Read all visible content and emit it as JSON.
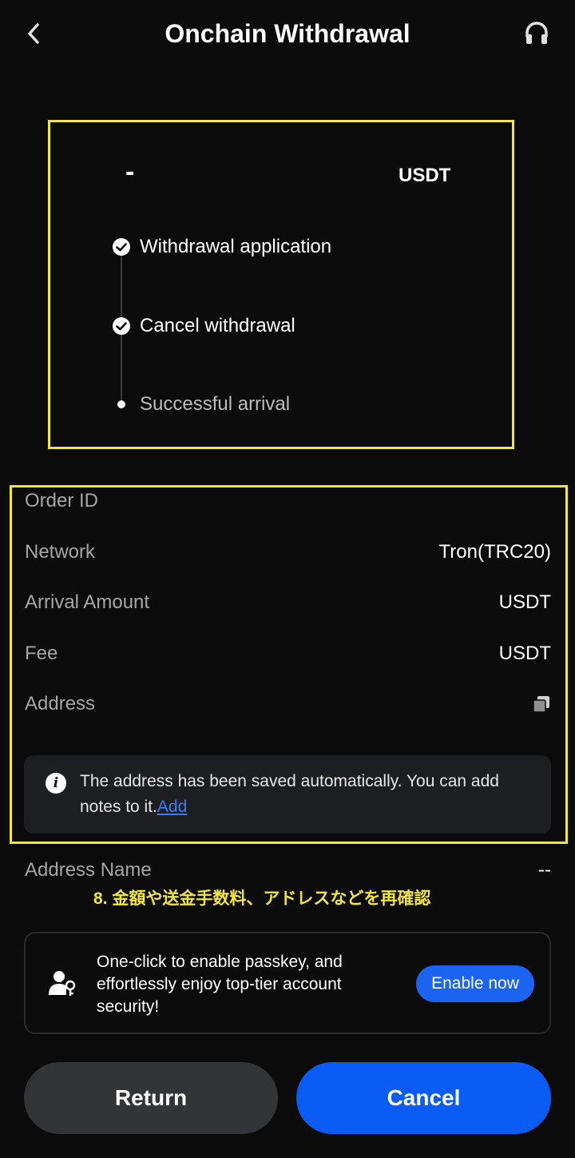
{
  "header": {
    "title": "Onchain Withdrawal",
    "back_icon": "chevron-left-icon",
    "support_icon": "headset-icon"
  },
  "summary": {
    "amount": "-",
    "unit": "USDT",
    "steps": [
      {
        "label": "Withdrawal application",
        "state": "done"
      },
      {
        "label": "Cancel withdrawal",
        "state": "done"
      },
      {
        "label": "Successful arrival",
        "state": "pending"
      }
    ]
  },
  "details": {
    "order_id": {
      "label": "Order ID",
      "value": ""
    },
    "network": {
      "label": "Network",
      "value": "Tron(TRC20)"
    },
    "arrival_amount": {
      "label": "Arrival Amount",
      "value": "USDT"
    },
    "fee": {
      "label": "Fee",
      "value": "USDT"
    },
    "address": {
      "label": "Address",
      "copy_icon": "copy-icon"
    },
    "address_name": {
      "label": "Address Name",
      "value": "--"
    }
  },
  "info": {
    "text": "The address has been saved automatically. You can add notes to it.",
    "link": "Add"
  },
  "annotation": "8. 金額や送金手数料、アドレスなどを再確認",
  "passkey": {
    "text": "One-click to enable passkey, and effortlessly enjoy top-tier account security!",
    "button": "Enable now"
  },
  "actions": {
    "return_label": "Return",
    "cancel_label": "Cancel"
  },
  "colors": {
    "background": "#0b0b0b",
    "accent": "#0a5cf5",
    "highlight": "#f2e53c",
    "link": "#3b7cf6"
  }
}
